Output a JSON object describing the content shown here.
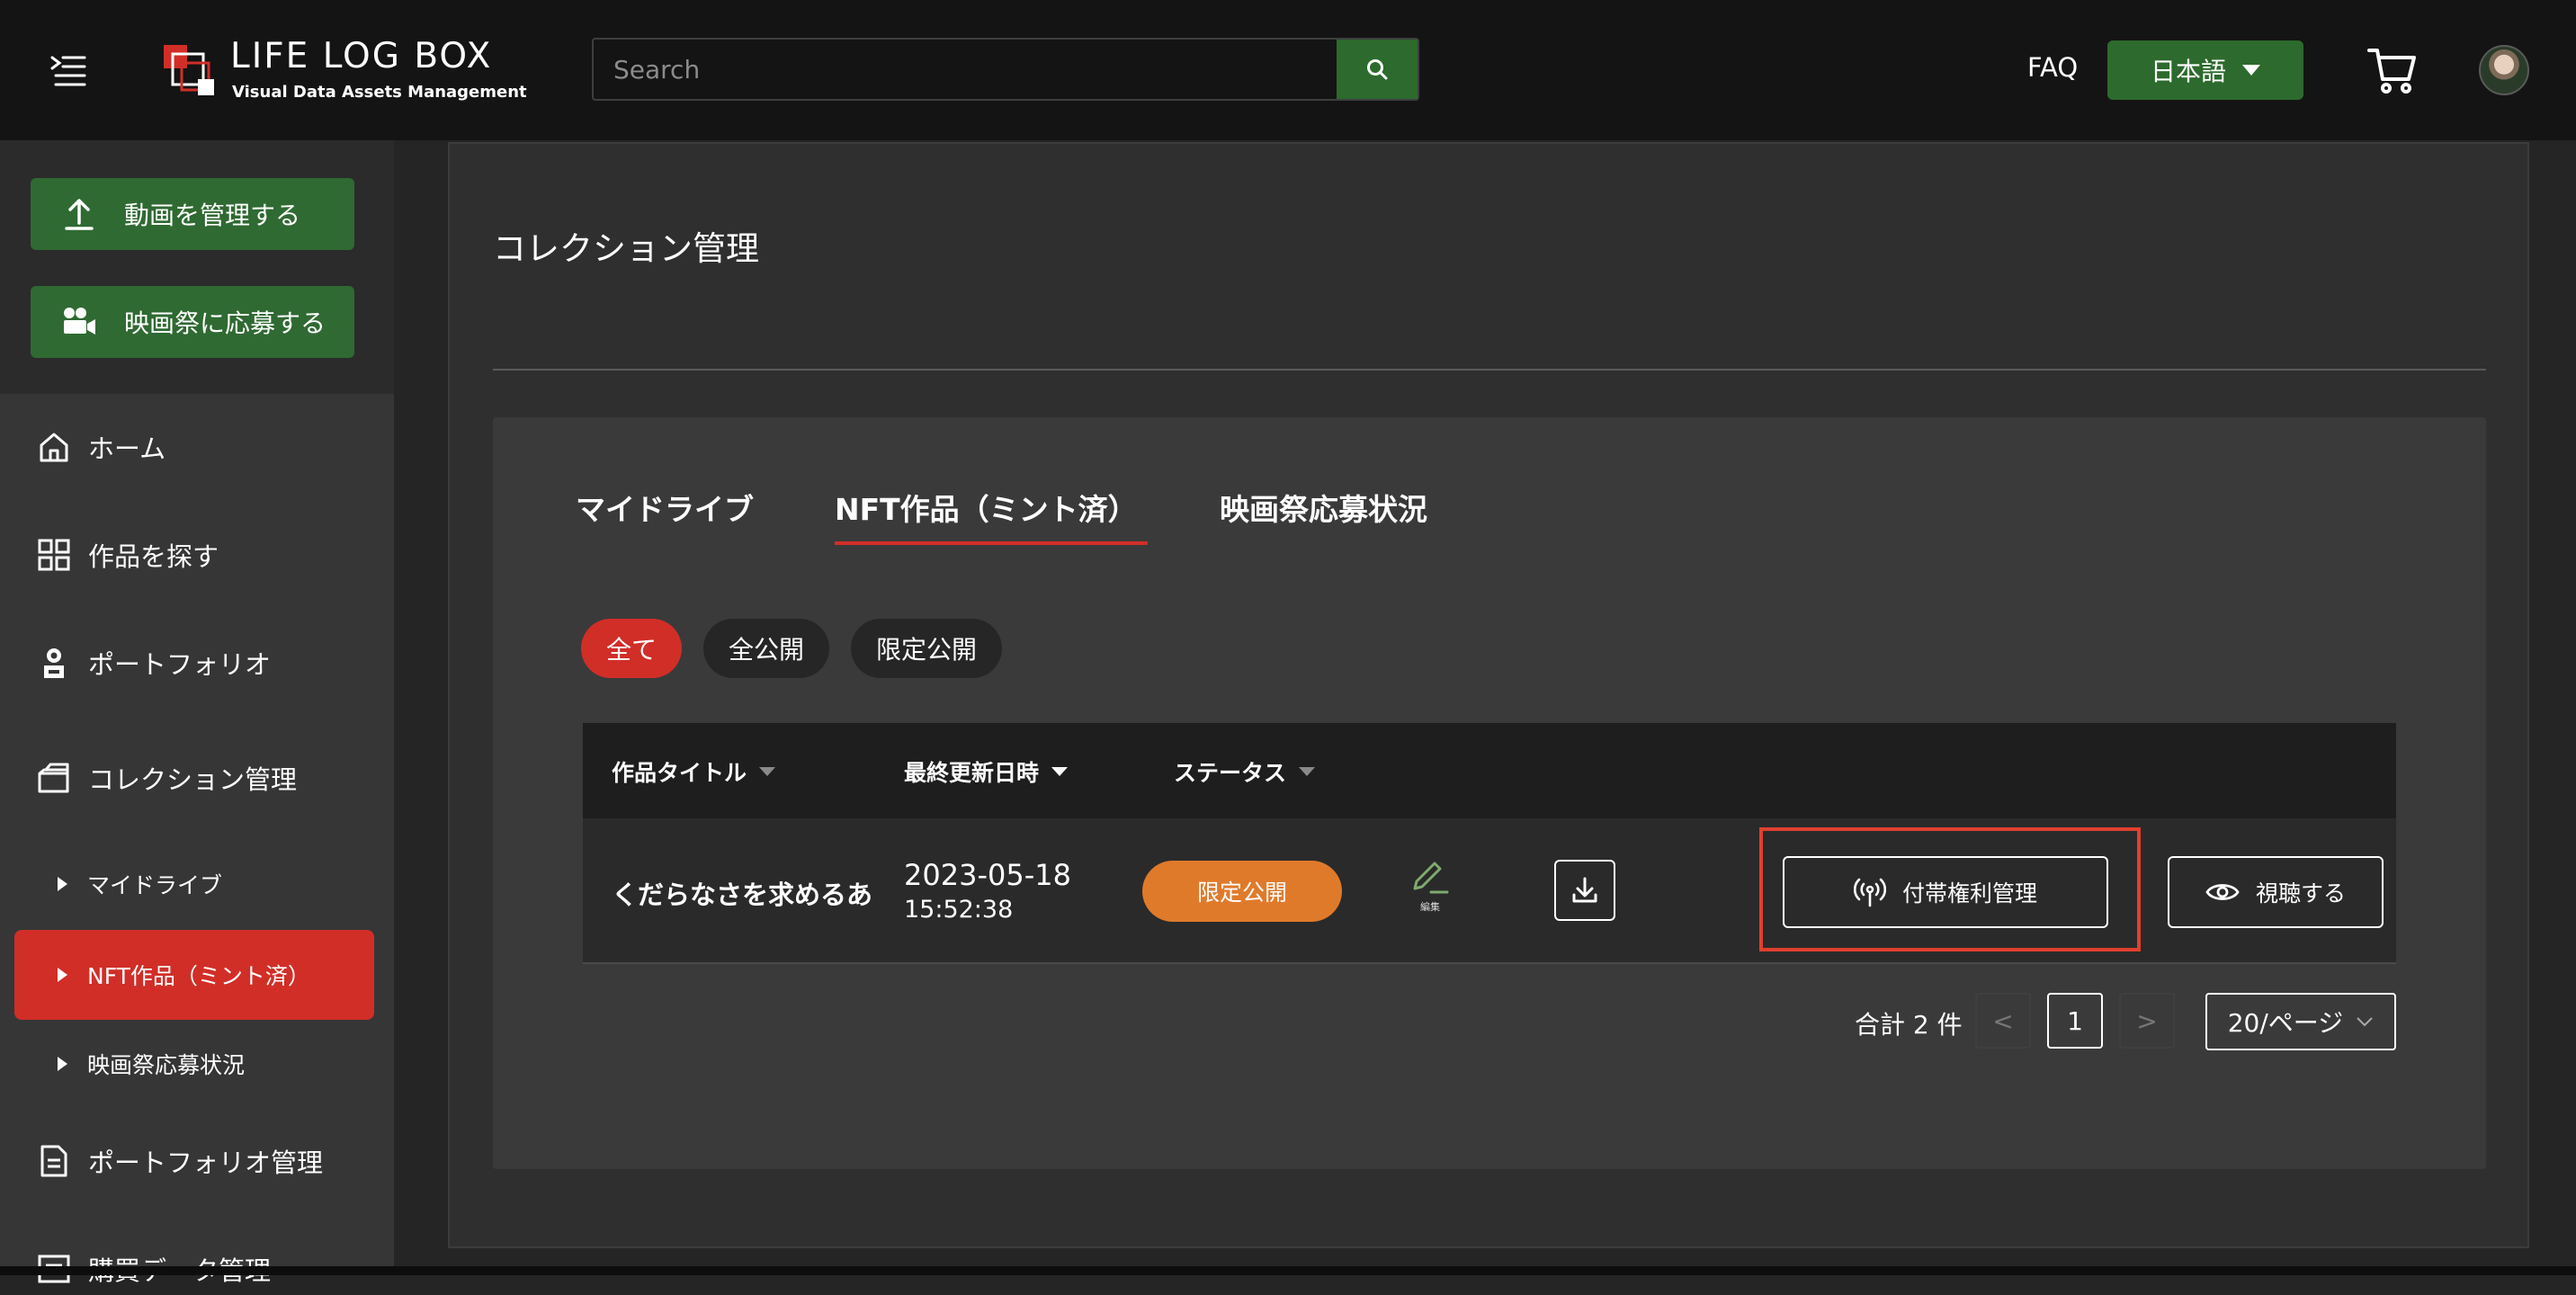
{
  "header": {
    "logo_title": "LIFE LOG BOX",
    "logo_subtitle": "Visual Data Assets Management",
    "search_placeholder": "Search",
    "faq": "FAQ",
    "language": "日本語"
  },
  "sidebar": {
    "manage_video": "動画を管理する",
    "apply_festival": "映画祭に応募する",
    "nav": {
      "home": "ホーム",
      "explore": "作品を探す",
      "portfolio": "ポートフォリオ",
      "collection": "コレクション管理",
      "my_drive": "マイドライブ",
      "nft_works": "NFT作品（ミント済）",
      "festival_status": "映画祭応募状況",
      "portfolio_manage": "ポートフォリオ管理",
      "purchase_data": "購買データ管理"
    }
  },
  "main": {
    "page_title": "コレクション管理",
    "tabs": [
      "マイドライブ",
      "NFT作品（ミント済）",
      "映画祭応募状況"
    ],
    "active_tab": "NFT作品（ミント済）",
    "filters": [
      "全て",
      "全公開",
      "限定公開"
    ],
    "active_filter": "全て",
    "table": {
      "columns": [
        "作品タイトル",
        "最終更新日時",
        "ステータス"
      ],
      "rows": [
        {
          "title": "くだらなさを求めるあ",
          "date": "2023-05-18",
          "time": "15:52:38",
          "status": "限定公開",
          "edit_label": "編集",
          "rights_button": "付帯権利管理",
          "view_button": "視聴する"
        }
      ]
    },
    "pagination": {
      "total": "合計 2 件",
      "prev": "<",
      "current_page": "1",
      "next": ">",
      "page_size": "20/ページ"
    }
  },
  "colors": {
    "accent_red": "#d12e28",
    "brand_green": "#2f6a32",
    "status_orange": "#e07a2b",
    "highlight": "#e0402f"
  }
}
